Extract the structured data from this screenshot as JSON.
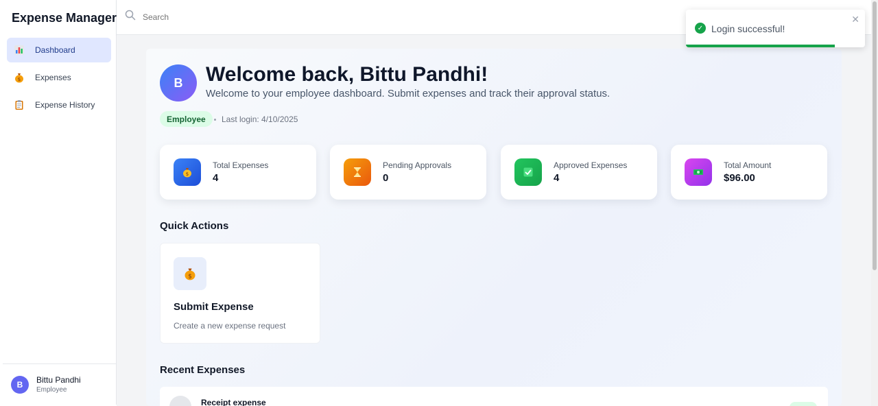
{
  "brand": "Expense Manager",
  "nav": [
    {
      "label": "Dashboard",
      "icon": "bar-chart-icon",
      "active": true
    },
    {
      "label": "Expenses",
      "icon": "money-bag-icon",
      "active": false
    },
    {
      "label": "Expense History",
      "icon": "clipboard-icon",
      "active": false
    }
  ],
  "user": {
    "initial": "B",
    "name": "Bittu Pandhi",
    "role": "Employee"
  },
  "search": {
    "placeholder": "Search"
  },
  "header": {
    "initial": "B",
    "welcome": "Welcome back, Bittu Pandhi!",
    "subtitle": "Welcome to your employee dashboard. Submit expenses and track their approval status.",
    "role_badge": "Employee",
    "last_login": "Last login: 4/10/2025"
  },
  "stats": [
    {
      "label": "Total Expenses",
      "value": "4",
      "icon": "money-bag-icon",
      "color": "#2563eb"
    },
    {
      "label": "Pending Approvals",
      "value": "0",
      "icon": "hourglass-icon",
      "color": "#f59e0b"
    },
    {
      "label": "Approved Expenses",
      "value": "4",
      "icon": "check-box-icon",
      "color": "#22c55e"
    },
    {
      "label": "Total Amount",
      "value": "$96.00",
      "icon": "cash-icon",
      "color": "#c026d3"
    }
  ],
  "quick_actions": {
    "title": "Quick Actions",
    "items": [
      {
        "title": "Submit Expense",
        "description": "Create a new expense request",
        "icon": "money-bag-icon"
      }
    ]
  },
  "recent": {
    "title": "Recent Expenses",
    "items": [
      {
        "title": "Receipt expense"
      }
    ]
  },
  "toast": {
    "message": "Login successful!",
    "status_color": "#16a34a",
    "progress": 0.83
  }
}
